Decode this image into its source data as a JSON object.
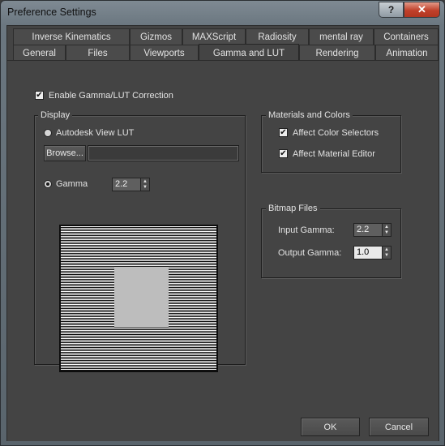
{
  "window": {
    "title": "Preference Settings",
    "help_label": "?",
    "close_label": "✕"
  },
  "tabs": {
    "row1": [
      "Inverse Kinematics",
      "Gizmos",
      "MAXScript",
      "Radiosity",
      "mental ray",
      "Containers"
    ],
    "row2": [
      "General",
      "Files",
      "Viewports",
      "Gamma and LUT",
      "Rendering",
      "Animation"
    ],
    "active": "Gamma and LUT"
  },
  "enable_gamma": {
    "label": "Enable Gamma/LUT Correction",
    "checked": true
  },
  "display": {
    "title": "Display",
    "autodesk_lut_label": "Autodesk View LUT",
    "browse_label": "Browse...",
    "lut_path_value": "",
    "gamma_label": "Gamma",
    "gamma_value": "2.2",
    "selected": "gamma"
  },
  "materials": {
    "title": "Materials and Colors",
    "affect_color_selectors": "Affect Color Selectors",
    "affect_material_editor": "Affect Material Editor"
  },
  "bitmap": {
    "title": "Bitmap Files",
    "input_gamma_label": "Input Gamma:",
    "input_gamma_value": "2.2",
    "output_gamma_label": "Output Gamma:",
    "output_gamma_value": "1.0"
  },
  "buttons": {
    "ok": "OK",
    "cancel": "Cancel"
  },
  "icons": {
    "check": "check-icon",
    "spin_up": "up-arrow-icon",
    "spin_down": "down-arrow-icon"
  }
}
